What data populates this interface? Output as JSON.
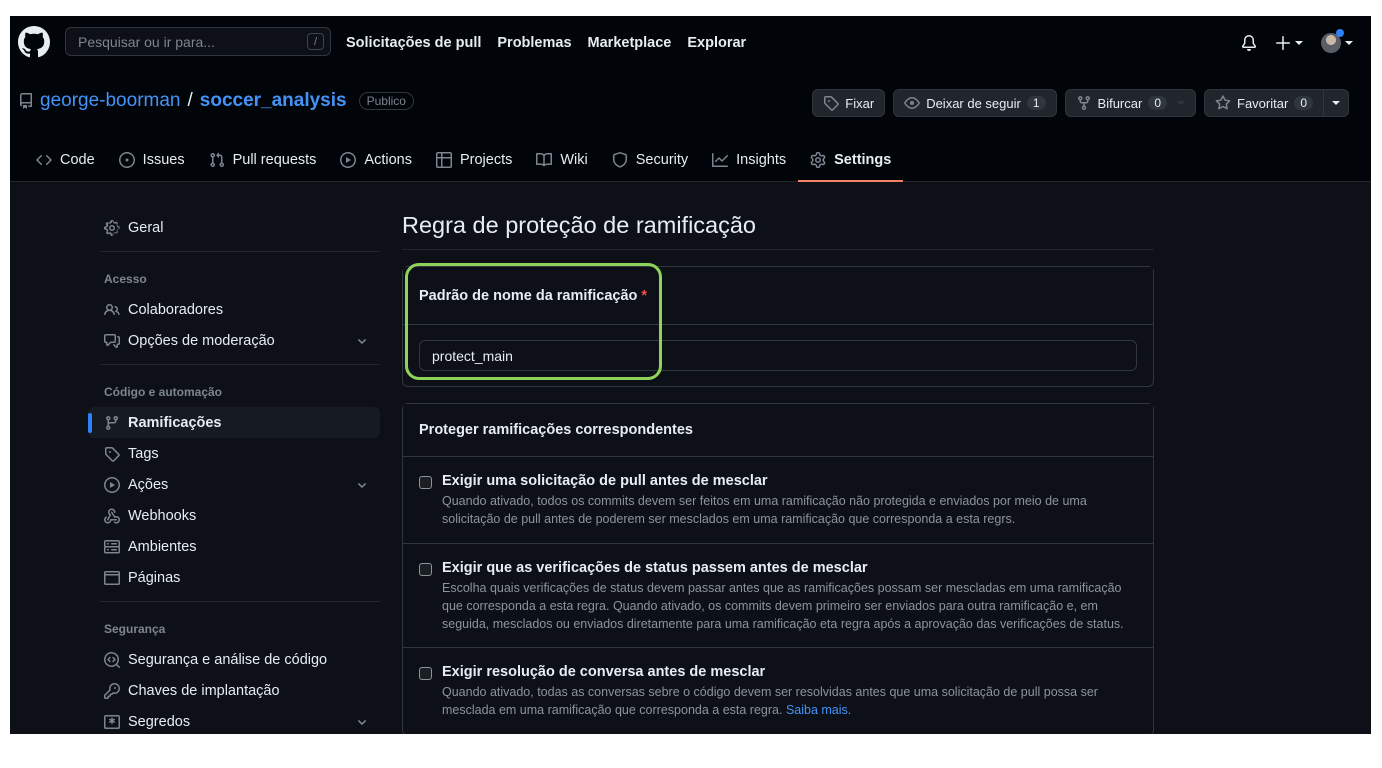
{
  "header": {
    "search_placeholder": "Pesquisar ou ir para...",
    "search_shortcut": "/",
    "nav": [
      "Solicitações de pull",
      "Problemas",
      "Marketplace",
      "Explorar"
    ]
  },
  "repo": {
    "owner": "george-boorman",
    "separator": "/",
    "name": "soccer_analysis",
    "visibility": "Publico",
    "actions": {
      "pin": "Fixar",
      "watch": "Deixar de seguir",
      "watch_count": "1",
      "fork": "Bifurcar",
      "fork_count": "0",
      "star": "Favoritar",
      "star_count": "0"
    },
    "tabs": [
      "Code",
      "Issues",
      "Pull requests",
      "Actions",
      "Projects",
      "Wiki",
      "Security",
      "Insights",
      "Settings"
    ]
  },
  "sidebar": {
    "general": "Geral",
    "access_heading": "Acesso",
    "access": [
      "Colaboradores",
      "Opções de moderação"
    ],
    "code_heading": "Código e automação",
    "code": [
      "Ramificações",
      "Tags",
      "Ações",
      "Webhooks",
      "Ambientes",
      "Páginas"
    ],
    "security_heading": "Segurança",
    "security": [
      "Segurança e análise de código",
      "Chaves de implantação",
      "Segredos"
    ]
  },
  "main": {
    "title": "Regra de proteção de ramificação",
    "pattern_label": "Padrão de nome da ramificação",
    "required_mark": "*",
    "pattern_value": "protect_main",
    "protect_heading": "Proteger ramificações correspondentes",
    "options": [
      {
        "title": "Exigir uma solicitação de pull antes de mesclar",
        "desc": "Quando ativado, todos os commits devem ser feitos em uma ramificação não protegida e enviados por meio de uma solicitação de pull antes de poderem ser mesclados em uma ramificação que corresponda a esta regrs."
      },
      {
        "title": "Exigir que as verificações de status passem antes de mesclar",
        "desc": "Escolha quais verificações de status devem passar antes que as ramificações possam ser mescladas em uma ramificação que corresponda a esta regra. Quando ativado, os commits devem primeiro ser enviados para outra ramificação e, em seguida, mesclados ou enviados diretamente para uma ramificação eta regra após a aprovação das verificações de status."
      },
      {
        "title": "Exigir resolução de conversa antes de mesclar",
        "desc": "Quando ativado, todas as conversas sebre o código devem ser resolvidas antes que uma solicitação de pull possa ser mesclada em uma ramificação que corresponda a esta regra.",
        "link": "Saiba mais."
      }
    ]
  },
  "colors": {
    "background": "#0d1117",
    "header": "#010409",
    "link": "#4493f8",
    "active_tab_underline": "#f78166",
    "highlight_ring": "#8fd45a"
  }
}
